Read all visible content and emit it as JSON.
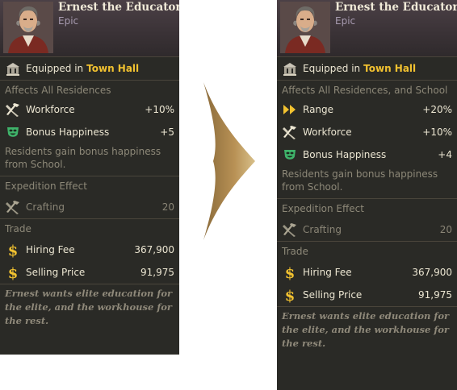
{
  "left": {
    "name": "Ernest the Educator",
    "rarity": "Epic",
    "equipped_prefix": "Equipped in",
    "equipped_place": "Town Hall",
    "affects": "Affects All Residences",
    "stats": [
      {
        "icon": "hammer-wrench-icon",
        "label": "Workforce",
        "value": "+10%"
      },
      {
        "icon": "happy-mask-icon",
        "label": "Bonus Happiness",
        "value": "+5"
      }
    ],
    "description": "Residents gain bonus happiness from School.",
    "expedition_title": "Expedition Effect",
    "expedition_label": "Crafting",
    "expedition_value": "20",
    "trade_title": "Trade",
    "hiring_fee_label": "Hiring Fee",
    "hiring_fee_value": "367,900",
    "selling_price_label": "Selling Price",
    "selling_price_value": "91,975",
    "flavor": "Ernest wants elite education for the elite, and the workhouse for the rest."
  },
  "right": {
    "name": "Ernest the Educator",
    "rarity": "Epic",
    "equipped_prefix": "Equipped in",
    "equipped_place": "Town Hall",
    "affects": "Affects All Residences, and School",
    "stats": [
      {
        "icon": "range-arrows-icon",
        "label": "Range",
        "value": "+20%"
      },
      {
        "icon": "hammer-wrench-icon",
        "label": "Workforce",
        "value": "+10%"
      },
      {
        "icon": "happy-mask-icon",
        "label": "Bonus Happiness",
        "value": "+4"
      }
    ],
    "description": "Residents gain bonus happiness from School.",
    "expedition_title": "Expedition Effect",
    "expedition_label": "Crafting",
    "expedition_value": "20",
    "trade_title": "Trade",
    "hiring_fee_label": "Hiring Fee",
    "hiring_fee_value": "367,900",
    "selling_price_label": "Selling Price",
    "selling_price_value": "91,975",
    "flavor": "Ernest wants elite education for the elite, and the workhouse for the rest."
  },
  "colors": {
    "highlight": "#f2c230",
    "card_bg": "#2a2a26",
    "arrow": "#b08a4a"
  }
}
